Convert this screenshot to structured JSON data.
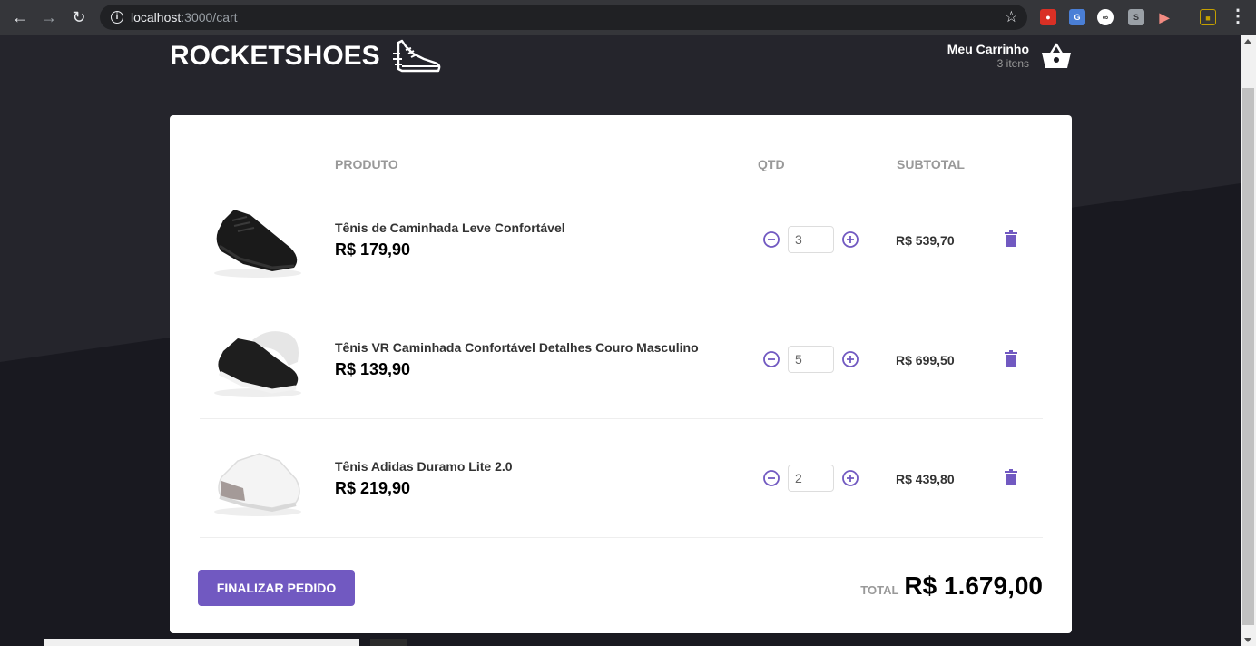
{
  "browser": {
    "url_host": "localhost",
    "url_path": ":3000/cart"
  },
  "header": {
    "logo_text": "ROCKETSHOES",
    "cart_title": "Meu Carrinho",
    "cart_count": "3 itens"
  },
  "table": {
    "headers": [
      "PRODUTO",
      "QTD",
      "SUBTOTAL"
    ]
  },
  "products": [
    {
      "title": "Tênis de Caminhada Leve Confortável",
      "price": "R$ 179,90",
      "quantity": "3",
      "subtotal": "R$ 539,70",
      "image": "black-sneaker-image"
    },
    {
      "title": "Tênis VR Caminhada Confortável Detalhes Couro Masculino",
      "price": "R$ 139,90",
      "quantity": "5",
      "subtotal": "R$ 699,50",
      "image": "black-white-sneaker-image"
    },
    {
      "title": "Tênis Adidas Duramo Lite 2.0",
      "price": "R$ 219,90",
      "quantity": "2",
      "subtotal": "R$ 439,80",
      "image": "white-sneaker-image"
    }
  ],
  "footer": {
    "finish_label": "FINALIZAR PEDIDO",
    "total_label": "TOTAL",
    "total_value": "R$ 1.679,00"
  },
  "colors": {
    "accent": "#7159c1",
    "background": "#191920"
  }
}
